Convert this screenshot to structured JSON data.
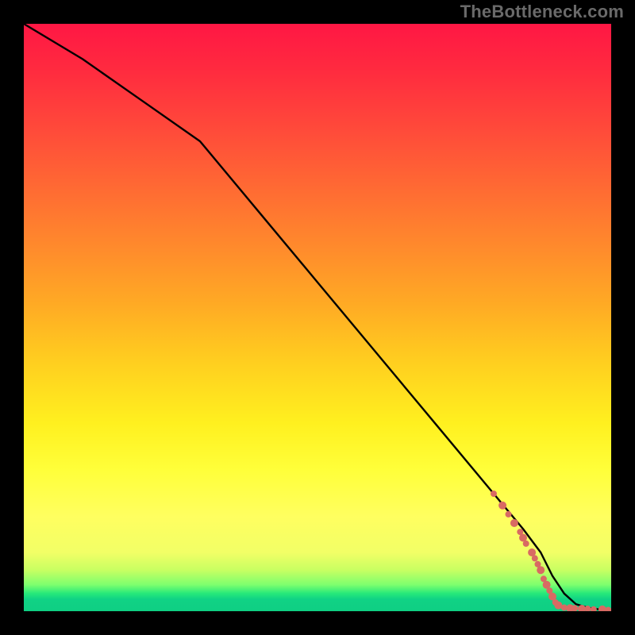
{
  "watermark": "TheBottleneck.com",
  "colors": {
    "dot": "#d86a63",
    "line": "#000000"
  },
  "chart_data": {
    "type": "line",
    "title": "",
    "xlabel": "",
    "ylabel": "",
    "xlim": [
      0,
      100
    ],
    "ylim": [
      0,
      100
    ],
    "grid": false,
    "legend": false,
    "series": [
      {
        "name": "curve",
        "x": [
          0,
          10,
          20,
          30,
          40,
          50,
          60,
          70,
          80,
          85,
          88,
          90,
          92,
          94,
          96,
          98,
          100
        ],
        "y": [
          100,
          94,
          87,
          80,
          68,
          56,
          44,
          32,
          20,
          14,
          10,
          6,
          3,
          1.2,
          0.6,
          0.3,
          0.2
        ]
      }
    ],
    "scatter": {
      "name": "dots",
      "points": [
        {
          "x": 80.0,
          "y": 20.0,
          "r": 4
        },
        {
          "x": 81.5,
          "y": 18.0,
          "r": 5
        },
        {
          "x": 82.5,
          "y": 16.5,
          "r": 4
        },
        {
          "x": 83.5,
          "y": 15.0,
          "r": 5
        },
        {
          "x": 84.5,
          "y": 13.5,
          "r": 4
        },
        {
          "x": 85.0,
          "y": 12.5,
          "r": 5
        },
        {
          "x": 85.5,
          "y": 11.5,
          "r": 4
        },
        {
          "x": 86.5,
          "y": 10.0,
          "r": 5
        },
        {
          "x": 87.0,
          "y": 9.0,
          "r": 4
        },
        {
          "x": 87.5,
          "y": 8.0,
          "r": 4
        },
        {
          "x": 88.0,
          "y": 7.0,
          "r": 5
        },
        {
          "x": 88.5,
          "y": 5.5,
          "r": 4
        },
        {
          "x": 89.0,
          "y": 4.5,
          "r": 5
        },
        {
          "x": 89.5,
          "y": 3.5,
          "r": 4
        },
        {
          "x": 90.0,
          "y": 2.5,
          "r": 5
        },
        {
          "x": 90.5,
          "y": 1.5,
          "r": 4
        },
        {
          "x": 91.0,
          "y": 1.0,
          "r": 5
        },
        {
          "x": 92.0,
          "y": 0.6,
          "r": 4
        },
        {
          "x": 93.0,
          "y": 0.5,
          "r": 5
        },
        {
          "x": 93.8,
          "y": 0.5,
          "r": 4
        },
        {
          "x": 95.0,
          "y": 0.4,
          "r": 5
        },
        {
          "x": 96.0,
          "y": 0.4,
          "r": 4
        },
        {
          "x": 97.0,
          "y": 0.3,
          "r": 4
        },
        {
          "x": 98.5,
          "y": 0.3,
          "r": 5
        },
        {
          "x": 99.5,
          "y": 0.2,
          "r": 4
        }
      ]
    }
  }
}
